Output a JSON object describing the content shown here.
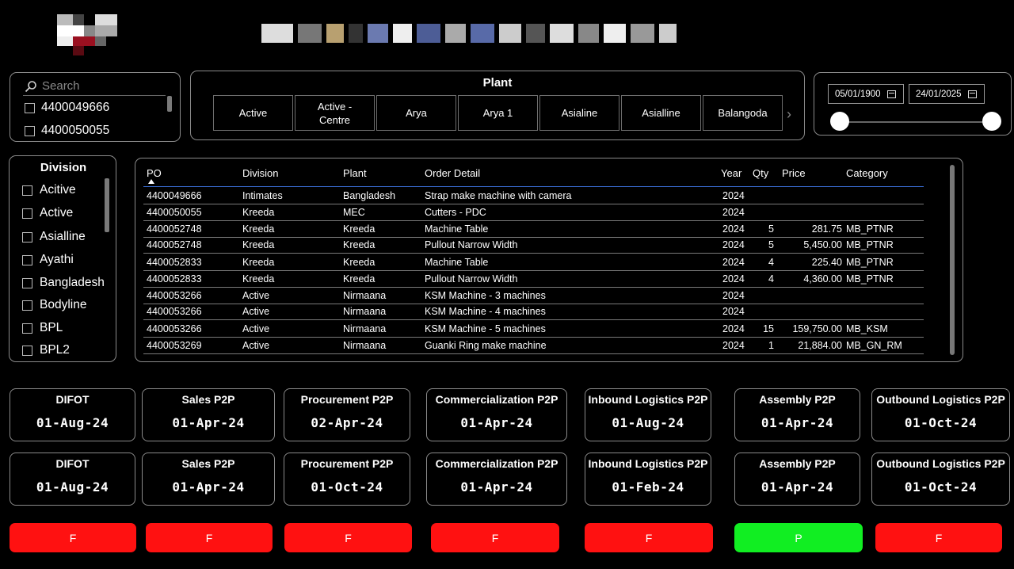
{
  "search": {
    "placeholder": "Search",
    "items": [
      "4400049666",
      "4400050055"
    ]
  },
  "plant": {
    "title": "Plant",
    "tiles": [
      "Active",
      "Active - Centre",
      "Arya",
      "Arya 1",
      "Asialine",
      "Asialline",
      "Balangoda"
    ]
  },
  "date_range": {
    "start": "05/01/1900",
    "end": "24/01/2025",
    "slider_start_fraction": 0,
    "slider_end_fraction": 1
  },
  "division": {
    "title": "Division",
    "items": [
      "Acitive",
      "Active",
      "Asialline",
      "Ayathi",
      "Bangladesh",
      "Bodyline",
      "BPL",
      "BPL2"
    ]
  },
  "table": {
    "columns": [
      "PO",
      "Division",
      "Plant",
      "Order Detail",
      "Year",
      "Qty",
      "Price",
      "Category"
    ],
    "sort_column": "PO",
    "rows": [
      {
        "po": "4400049666",
        "division": "Intimates",
        "plant": "Bangladesh",
        "detail": "Strap make machine with camera",
        "year": "2024",
        "qty": "",
        "price": "",
        "category": ""
      },
      {
        "po": "4400050055",
        "division": "Kreeda",
        "plant": "MEC",
        "detail": "Cutters - PDC",
        "year": "2024",
        "qty": "",
        "price": "",
        "category": ""
      },
      {
        "po": "4400052748",
        "division": "Kreeda",
        "plant": "Kreeda",
        "detail": "Machine Table",
        "year": "2024",
        "qty": "5",
        "price": "281.75",
        "category": "MB_PTNR"
      },
      {
        "po": "4400052748",
        "division": "Kreeda",
        "plant": "Kreeda",
        "detail": "Pullout Narrow Width",
        "year": "2024",
        "qty": "5",
        "price": "5,450.00",
        "category": "MB_PTNR"
      },
      {
        "po": "4400052833",
        "division": "Kreeda",
        "plant": "Kreeda",
        "detail": "Machine Table",
        "year": "2024",
        "qty": "4",
        "price": "225.40",
        "category": "MB_PTNR"
      },
      {
        "po": "4400052833",
        "division": "Kreeda",
        "plant": "Kreeda",
        "detail": "Pullout Narrow Width",
        "year": "2024",
        "qty": "4",
        "price": "4,360.00",
        "category": "MB_PTNR"
      },
      {
        "po": "4400053266",
        "division": "Active",
        "plant": "Nirmaana",
        "detail": "KSM Machine - 3 machines",
        "year": "2024",
        "qty": "",
        "price": "",
        "category": ""
      },
      {
        "po": "4400053266",
        "division": "Active",
        "plant": "Nirmaana",
        "detail": "KSM Machine - 4 machines",
        "year": "2024",
        "qty": "",
        "price": "",
        "category": ""
      },
      {
        "po": "4400053266",
        "division": "Active",
        "plant": "Nirmaana",
        "detail": "KSM Machine - 5 machines",
        "year": "2024",
        "qty": "15",
        "price": "159,750.00",
        "category": "MB_KSM"
      },
      {
        "po": "4400053269",
        "division": "Active",
        "plant": "Nirmaana",
        "detail": "Guanki Ring make machine",
        "year": "2024",
        "qty": "1",
        "price": "21,884.00",
        "category": "MB_GN_RM"
      }
    ]
  },
  "cards_row1": [
    {
      "label": "DIFOT",
      "value": "01-Aug-24"
    },
    {
      "label": "Sales P2P",
      "value": "01-Apr-24"
    },
    {
      "label": "Procurement P2P",
      "value": "02-Apr-24"
    },
    {
      "label": "Commercialization P2P",
      "value": "01-Apr-24"
    },
    {
      "label": "Inbound Logistics P2P",
      "value": "01-Aug-24"
    },
    {
      "label": "Assembly P2P",
      "value": "01-Apr-24"
    },
    {
      "label": "Outbound Logistics P2P",
      "value": "01-Oct-24"
    }
  ],
  "cards_row2": [
    {
      "label": "DIFOT",
      "value": "01-Aug-24"
    },
    {
      "label": "Sales P2P",
      "value": "01-Apr-24"
    },
    {
      "label": "Procurement P2P",
      "value": "01-Oct-24"
    },
    {
      "label": "Commercialization P2P",
      "value": "01-Apr-24"
    },
    {
      "label": "Inbound Logistics P2P",
      "value": "01-Feb-24"
    },
    {
      "label": "Assembly P2P",
      "value": "01-Apr-24"
    },
    {
      "label": "Outbound Logistics P2P",
      "value": "01-Oct-24"
    }
  ],
  "status": [
    {
      "label": "F",
      "color": "#ff1111"
    },
    {
      "label": "F",
      "color": "#ff1111"
    },
    {
      "label": "F",
      "color": "#ff1111"
    },
    {
      "label": "F",
      "color": "#ff1111"
    },
    {
      "label": "F",
      "color": "#ff1111"
    },
    {
      "label": "P",
      "color": "#11ee22"
    },
    {
      "label": "F",
      "color": "#ff1111"
    }
  ],
  "colors": {
    "fail": "#ff1111",
    "pass": "#11ee22",
    "accent": "#3a6fd8"
  }
}
